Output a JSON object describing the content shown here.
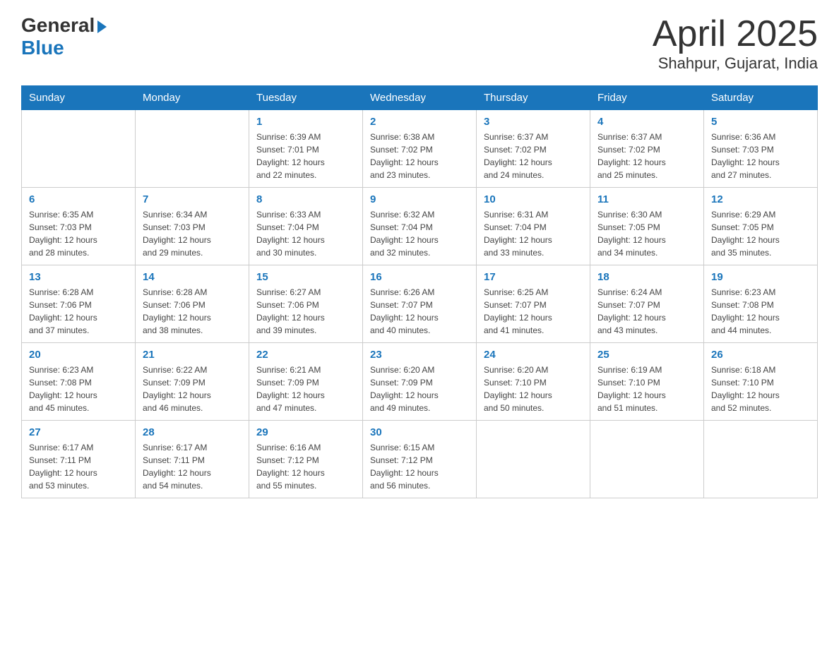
{
  "header": {
    "logo_general": "General",
    "logo_blue": "Blue",
    "title": "April 2025",
    "subtitle": "Shahpur, Gujarat, India"
  },
  "days_of_week": [
    "Sunday",
    "Monday",
    "Tuesday",
    "Wednesday",
    "Thursday",
    "Friday",
    "Saturday"
  ],
  "weeks": [
    [
      {
        "num": "",
        "detail": ""
      },
      {
        "num": "",
        "detail": ""
      },
      {
        "num": "1",
        "detail": "Sunrise: 6:39 AM\nSunset: 7:01 PM\nDaylight: 12 hours\nand 22 minutes."
      },
      {
        "num": "2",
        "detail": "Sunrise: 6:38 AM\nSunset: 7:02 PM\nDaylight: 12 hours\nand 23 minutes."
      },
      {
        "num": "3",
        "detail": "Sunrise: 6:37 AM\nSunset: 7:02 PM\nDaylight: 12 hours\nand 24 minutes."
      },
      {
        "num": "4",
        "detail": "Sunrise: 6:37 AM\nSunset: 7:02 PM\nDaylight: 12 hours\nand 25 minutes."
      },
      {
        "num": "5",
        "detail": "Sunrise: 6:36 AM\nSunset: 7:03 PM\nDaylight: 12 hours\nand 27 minutes."
      }
    ],
    [
      {
        "num": "6",
        "detail": "Sunrise: 6:35 AM\nSunset: 7:03 PM\nDaylight: 12 hours\nand 28 minutes."
      },
      {
        "num": "7",
        "detail": "Sunrise: 6:34 AM\nSunset: 7:03 PM\nDaylight: 12 hours\nand 29 minutes."
      },
      {
        "num": "8",
        "detail": "Sunrise: 6:33 AM\nSunset: 7:04 PM\nDaylight: 12 hours\nand 30 minutes."
      },
      {
        "num": "9",
        "detail": "Sunrise: 6:32 AM\nSunset: 7:04 PM\nDaylight: 12 hours\nand 32 minutes."
      },
      {
        "num": "10",
        "detail": "Sunrise: 6:31 AM\nSunset: 7:04 PM\nDaylight: 12 hours\nand 33 minutes."
      },
      {
        "num": "11",
        "detail": "Sunrise: 6:30 AM\nSunset: 7:05 PM\nDaylight: 12 hours\nand 34 minutes."
      },
      {
        "num": "12",
        "detail": "Sunrise: 6:29 AM\nSunset: 7:05 PM\nDaylight: 12 hours\nand 35 minutes."
      }
    ],
    [
      {
        "num": "13",
        "detail": "Sunrise: 6:28 AM\nSunset: 7:06 PM\nDaylight: 12 hours\nand 37 minutes."
      },
      {
        "num": "14",
        "detail": "Sunrise: 6:28 AM\nSunset: 7:06 PM\nDaylight: 12 hours\nand 38 minutes."
      },
      {
        "num": "15",
        "detail": "Sunrise: 6:27 AM\nSunset: 7:06 PM\nDaylight: 12 hours\nand 39 minutes."
      },
      {
        "num": "16",
        "detail": "Sunrise: 6:26 AM\nSunset: 7:07 PM\nDaylight: 12 hours\nand 40 minutes."
      },
      {
        "num": "17",
        "detail": "Sunrise: 6:25 AM\nSunset: 7:07 PM\nDaylight: 12 hours\nand 41 minutes."
      },
      {
        "num": "18",
        "detail": "Sunrise: 6:24 AM\nSunset: 7:07 PM\nDaylight: 12 hours\nand 43 minutes."
      },
      {
        "num": "19",
        "detail": "Sunrise: 6:23 AM\nSunset: 7:08 PM\nDaylight: 12 hours\nand 44 minutes."
      }
    ],
    [
      {
        "num": "20",
        "detail": "Sunrise: 6:23 AM\nSunset: 7:08 PM\nDaylight: 12 hours\nand 45 minutes."
      },
      {
        "num": "21",
        "detail": "Sunrise: 6:22 AM\nSunset: 7:09 PM\nDaylight: 12 hours\nand 46 minutes."
      },
      {
        "num": "22",
        "detail": "Sunrise: 6:21 AM\nSunset: 7:09 PM\nDaylight: 12 hours\nand 47 minutes."
      },
      {
        "num": "23",
        "detail": "Sunrise: 6:20 AM\nSunset: 7:09 PM\nDaylight: 12 hours\nand 49 minutes."
      },
      {
        "num": "24",
        "detail": "Sunrise: 6:20 AM\nSunset: 7:10 PM\nDaylight: 12 hours\nand 50 minutes."
      },
      {
        "num": "25",
        "detail": "Sunrise: 6:19 AM\nSunset: 7:10 PM\nDaylight: 12 hours\nand 51 minutes."
      },
      {
        "num": "26",
        "detail": "Sunrise: 6:18 AM\nSunset: 7:10 PM\nDaylight: 12 hours\nand 52 minutes."
      }
    ],
    [
      {
        "num": "27",
        "detail": "Sunrise: 6:17 AM\nSunset: 7:11 PM\nDaylight: 12 hours\nand 53 minutes."
      },
      {
        "num": "28",
        "detail": "Sunrise: 6:17 AM\nSunset: 7:11 PM\nDaylight: 12 hours\nand 54 minutes."
      },
      {
        "num": "29",
        "detail": "Sunrise: 6:16 AM\nSunset: 7:12 PM\nDaylight: 12 hours\nand 55 minutes."
      },
      {
        "num": "30",
        "detail": "Sunrise: 6:15 AM\nSunset: 7:12 PM\nDaylight: 12 hours\nand 56 minutes."
      },
      {
        "num": "",
        "detail": ""
      },
      {
        "num": "",
        "detail": ""
      },
      {
        "num": "",
        "detail": ""
      }
    ]
  ]
}
